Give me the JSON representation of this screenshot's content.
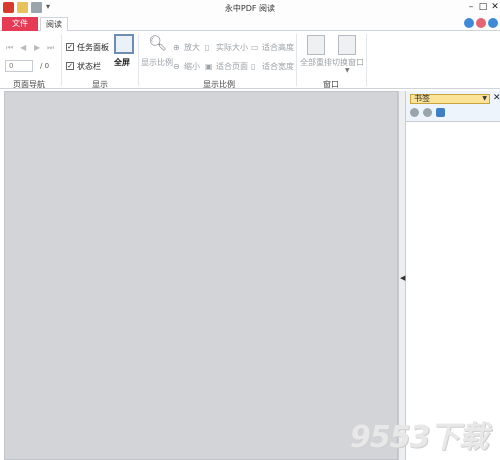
{
  "title_bar": {
    "title": "永中PDF 阅读",
    "dropdown_glyph": "▾",
    "min": "–",
    "max": "□",
    "close": "✕"
  },
  "tabs": {
    "file": "文件",
    "read": "阅读"
  },
  "ribbon": {
    "nav": {
      "first": "⏮",
      "prev": "◀",
      "next": "▶",
      "last": "⏭",
      "page_value": "0",
      "page_total": "/ 0",
      "group_label": "页面导航"
    },
    "display": {
      "taskpane": "任务面板",
      "statusbar": "状态栏",
      "taskpane_checked": true,
      "statusbar_checked": true,
      "fullscreen": "全屏",
      "group_label": "显示"
    },
    "zoom": {
      "show_ratio": "显示比例",
      "zoom_in": "放大",
      "zoom_out": "缩小",
      "actual_size": "实际大小",
      "fit_page": "适合页面",
      "fit_height": "适合高度",
      "fit_width": "适合宽度",
      "group_label": "显示比例"
    },
    "window": {
      "rearrange": "全部重排",
      "switch": "切换窗口",
      "group_label": "窗口"
    }
  },
  "sidebar": {
    "selector": "书签",
    "close": "✕"
  },
  "watermark": {
    "text": "9553下载"
  },
  "colors": {
    "file_tab": "#e73a55",
    "doc_bg": "#d3d4d8",
    "sidebar_bg": "#eef4fb",
    "selector_bg": "#fbe39a"
  }
}
